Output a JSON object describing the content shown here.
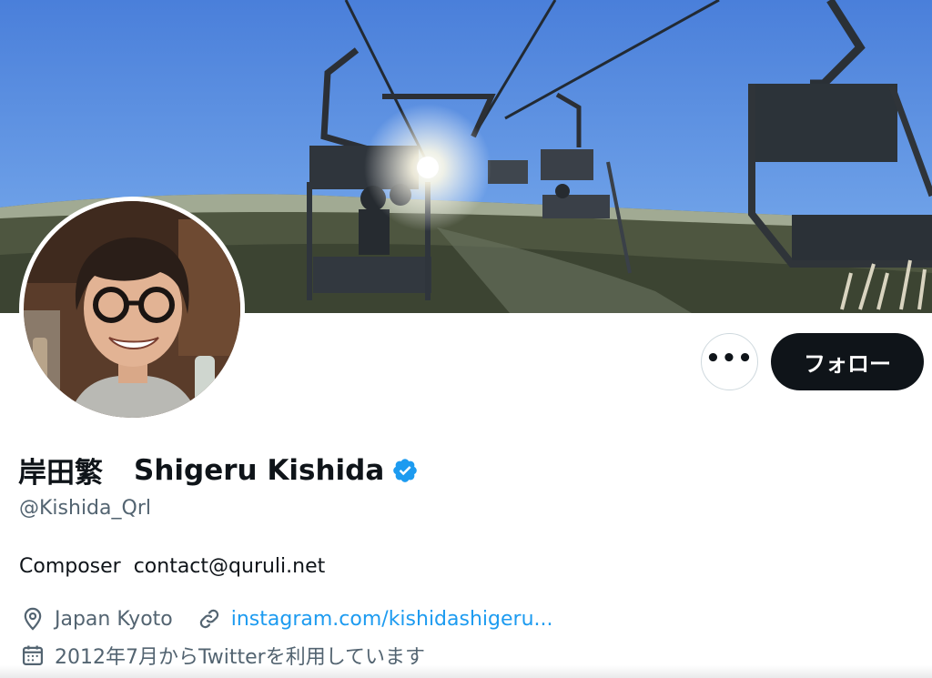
{
  "profile": {
    "name_jp": "岸田繁",
    "name_en": "Shigeru Kishida",
    "handle": "@Kishida_Qrl",
    "bio": "Composer  contact@quruli.net",
    "location": "Japan Kyoto",
    "website": "instagram.com/kishidashigeru...",
    "joined": "2012年7月からTwitterを利用しています",
    "verified": true
  },
  "actions": {
    "more_label": "•••",
    "follow_label": "フォロー"
  },
  "colors": {
    "accent": "#1d9bf0",
    "text": "#0f1419",
    "secondary_text": "#536471",
    "follow_button_bg": "#0f1419",
    "verified_badge": "#1d9bf0"
  },
  "icons": {
    "more": "more-dots-icon",
    "verified": "verified-badge-icon",
    "location": "location-pin-icon",
    "link": "link-chain-icon",
    "calendar": "calendar-icon"
  }
}
